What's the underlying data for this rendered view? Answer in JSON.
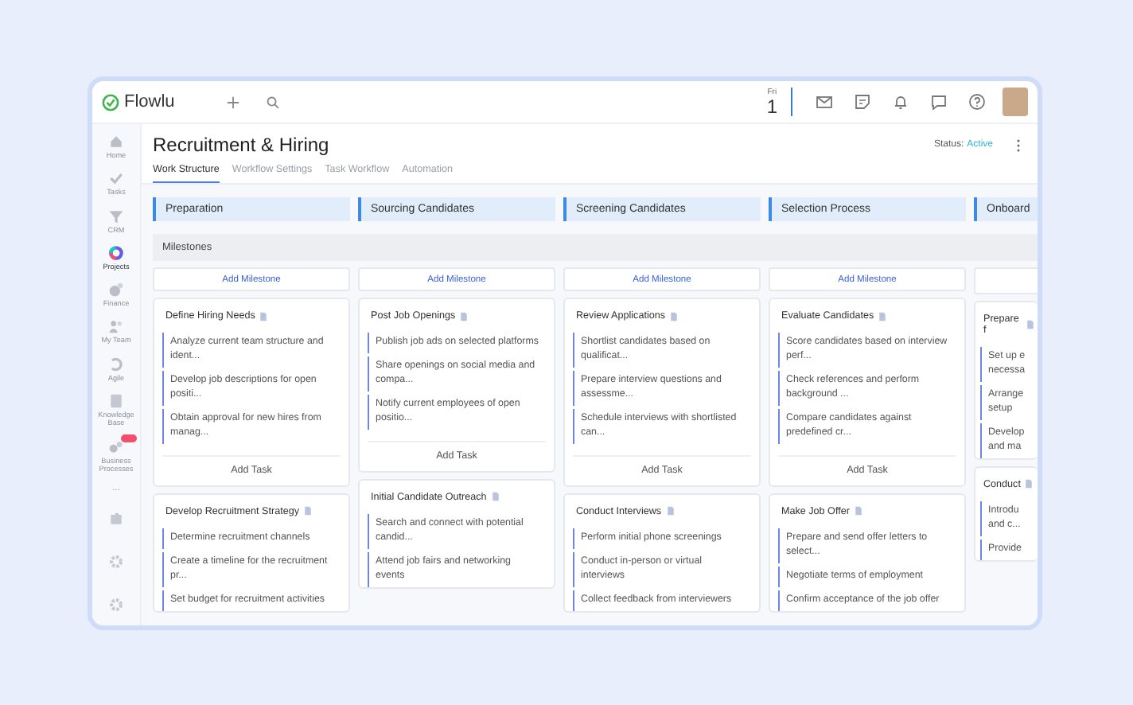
{
  "topbar": {
    "logo": "Flowlu",
    "date": {
      "weekday": "Fri",
      "day": "1"
    }
  },
  "sidebar": {
    "items": [
      {
        "label": "Home",
        "selected": false
      },
      {
        "label": "Tasks",
        "selected": false
      },
      {
        "label": "CRM",
        "selected": false
      },
      {
        "label": "Projects",
        "selected": true
      },
      {
        "label": "Finance",
        "selected": false
      },
      {
        "label": "My Team",
        "selected": false
      },
      {
        "label": "Agile",
        "selected": false
      },
      {
        "label": "Knowledge Base",
        "selected": false
      },
      {
        "label": "Business Processes",
        "selected": false,
        "badge": true
      }
    ],
    "more": "..."
  },
  "header": {
    "title": "Recruitment & Hiring",
    "status_label": "Status:",
    "status": "Active"
  },
  "tabs": [
    {
      "label": "Work Structure",
      "selected": true
    },
    {
      "label": "Workflow Settings",
      "selected": false
    },
    {
      "label": "Task Workflow",
      "selected": false
    },
    {
      "label": "Automation",
      "selected": false
    }
  ],
  "milestones_label": "Milestones",
  "columns": [
    {
      "stage": "Preparation",
      "add_milestone": "Add Milestone",
      "cards": [
        {
          "title": "Define Hiring Needs",
          "tasks": [
            "Analyze current team structure and ident...",
            "Develop job descriptions for open positi...",
            "Obtain approval for new hires from manag..."
          ],
          "add_task": "Add Task"
        },
        {
          "title": "Develop Recruitment Strategy",
          "tasks": [
            "Determine recruitment channels",
            "Create a timeline for the recruitment pr...",
            "Set budget for recruitment activities"
          ]
        }
      ]
    },
    {
      "stage": "Sourcing Candidates",
      "add_milestone": "Add Milestone",
      "cards": [
        {
          "title": "Post Job Openings",
          "tasks": [
            "Publish job ads on selected platforms",
            "Share openings on social media and compa...",
            "Notify current employees of open positio..."
          ],
          "add_task": "Add Task"
        },
        {
          "title": "Initial Candidate Outreach",
          "tasks": [
            "Search and connect with potential candid...",
            "Attend job fairs and networking events"
          ]
        }
      ]
    },
    {
      "stage": "Screening Candidates",
      "add_milestone": "Add Milestone",
      "cards": [
        {
          "title": "Review Applications",
          "tasks": [
            "Shortlist candidates based on qualificat...",
            "Prepare interview questions and assessme...",
            "Schedule interviews with shortlisted can..."
          ],
          "add_task": "Add Task"
        },
        {
          "title": "Conduct Interviews",
          "tasks": [
            "Perform initial phone screenings",
            "Conduct in-person or virtual interviews",
            "Collect feedback from interviewers"
          ]
        }
      ]
    },
    {
      "stage": "Selection Process",
      "add_milestone": "Add Milestone",
      "cards": [
        {
          "title": "Evaluate Candidates",
          "tasks": [
            "Score candidates based on interview perf...",
            "Check references and perform background ...",
            "Compare candidates against predefined cr..."
          ],
          "add_task": "Add Task"
        },
        {
          "title": "Make Job Offer",
          "tasks": [
            "Prepare and send offer letters to select...",
            "Negotiate terms of employment",
            "Confirm acceptance of the job offer"
          ]
        }
      ]
    },
    {
      "stage": "Onboard",
      "cards": [
        {
          "title": "Prepare f",
          "tasks": [
            "Set up e necessa",
            "Arrange setup",
            "Develop and ma"
          ]
        },
        {
          "title": "Conduct",
          "tasks": [
            "Introdu and c...",
            "Provide"
          ]
        }
      ]
    }
  ]
}
